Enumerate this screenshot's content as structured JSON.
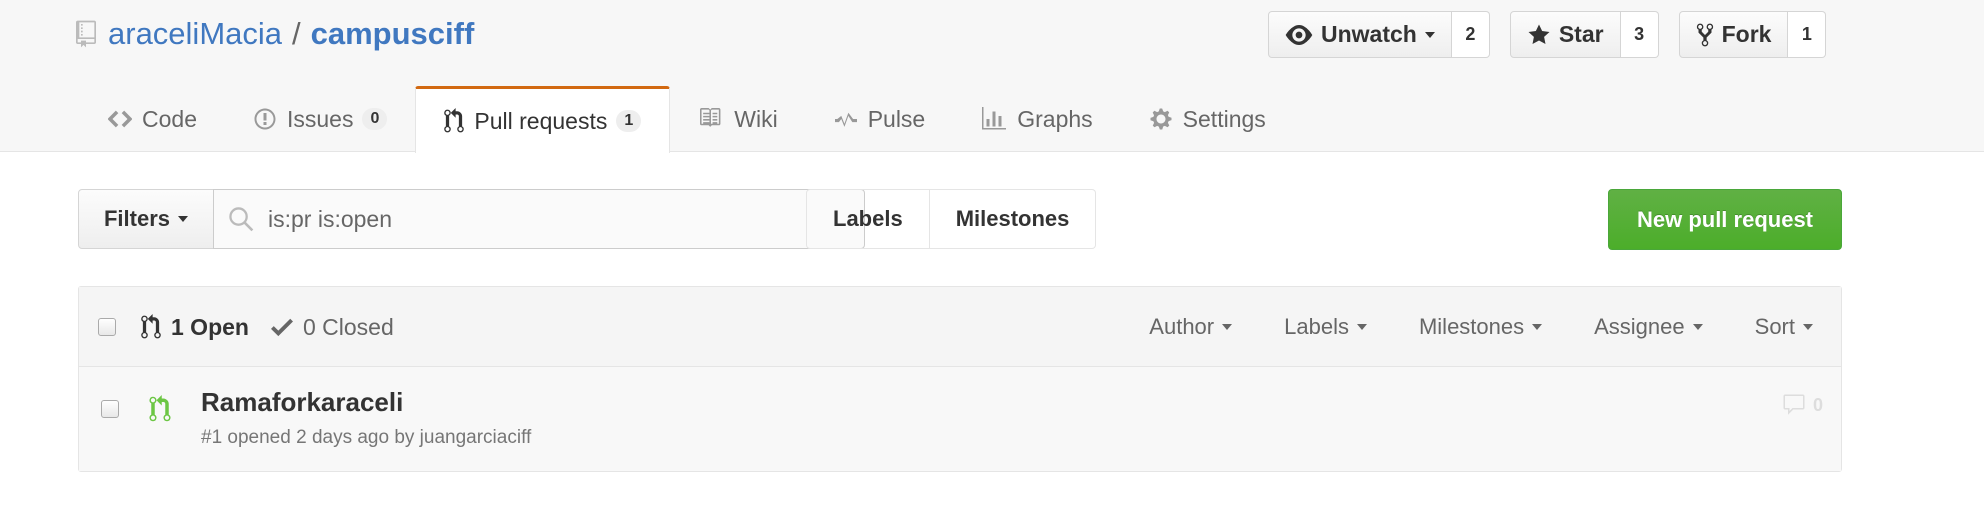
{
  "repo": {
    "owner": "araceliMacia",
    "separator": "/",
    "name": "campusciff"
  },
  "actions": [
    {
      "label": "Unwatch",
      "count": "2",
      "icon": "eye-icon"
    },
    {
      "label": "Star",
      "count": "3",
      "icon": "star-icon"
    },
    {
      "label": "Fork",
      "count": "1",
      "icon": "fork-icon"
    }
  ],
  "nav": {
    "code": "Code",
    "issues": "Issues",
    "issues_count": "0",
    "pulls": "Pull requests",
    "pulls_count": "1",
    "wiki": "Wiki",
    "pulse": "Pulse",
    "graphs": "Graphs",
    "settings": "Settings",
    "selected_accent": "#d26911"
  },
  "filter": {
    "filters_label": "Filters",
    "search_value": "is:pr is:open",
    "labels": "Labels",
    "milestones": "Milestones",
    "new_pr": "New pull request",
    "new_pr_color": "#55a532"
  },
  "list": {
    "open": "1 Open",
    "closed": "0 Closed",
    "sorts": [
      "Author",
      "Labels",
      "Milestones",
      "Assignee",
      "Sort"
    ],
    "items": [
      {
        "title": "Ramaforkaraceli",
        "meta": "#1 opened 2 days ago by juangarciaciff",
        "comments": "0"
      }
    ]
  }
}
